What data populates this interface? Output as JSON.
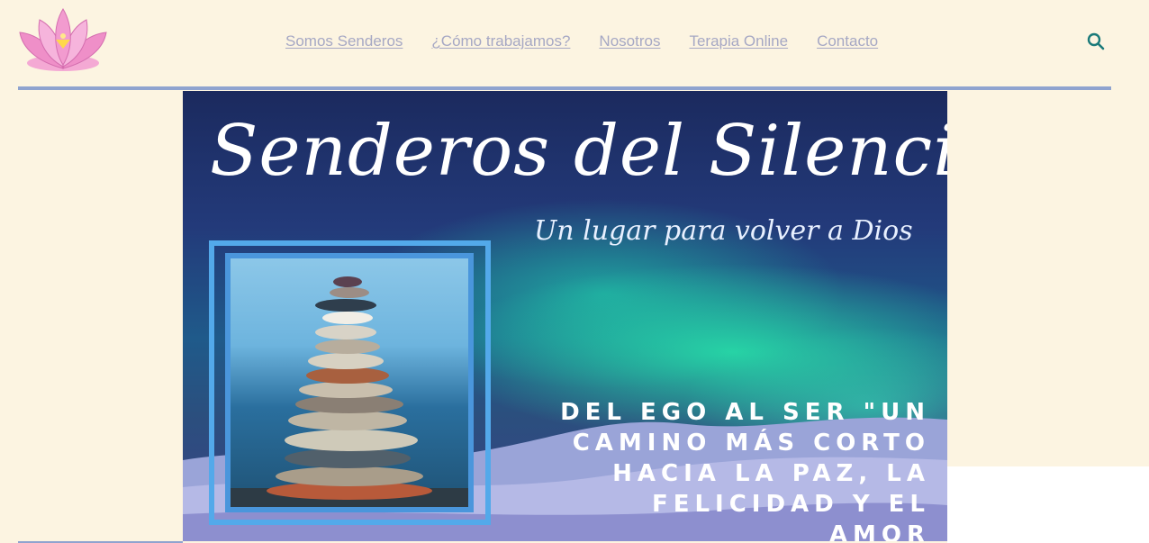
{
  "header": {
    "logo_icon": "lotus-flower-icon",
    "nav": [
      {
        "label": "Somos Senderos"
      },
      {
        "label": "¿Cómo trabajamos?"
      },
      {
        "label": "Nosotros"
      },
      {
        "label": "Terapia Online"
      },
      {
        "label": "Contacto"
      }
    ],
    "search_icon": "search-icon"
  },
  "hero": {
    "title": "Senderos del Silencio",
    "subtitle": "Un lugar para volver a Dios",
    "tagline_lines": [
      "DEL EGO AL SER \"UN",
      "CAMINO MÁS CORTO",
      "HACIA LA PAZ, LA",
      "FELICIDAD Y EL AMOR"
    ]
  },
  "colors": {
    "background": "#fcf4e1",
    "nav_link": "#a6a8c4",
    "divider": "#8fa3cf",
    "search_icon": "#1a7a7a",
    "frame": "#53a9ea"
  }
}
